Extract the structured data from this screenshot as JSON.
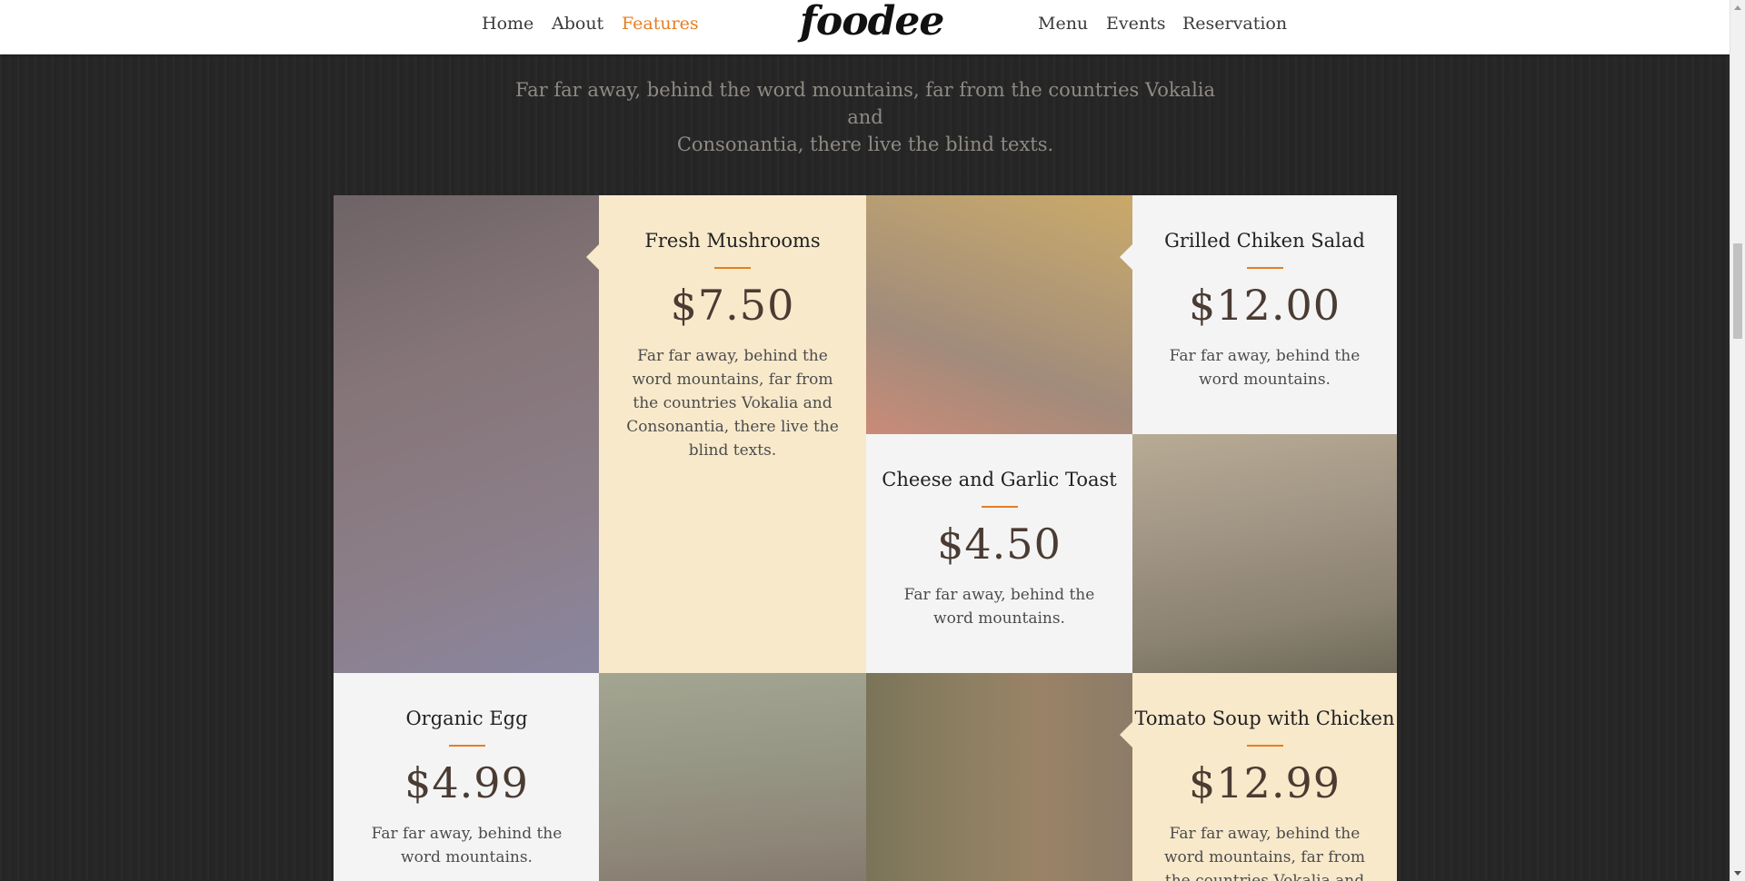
{
  "nav": {
    "left": [
      "Home",
      "About",
      "Features"
    ],
    "active": "Features",
    "right": [
      "Menu",
      "Events",
      "Reservation"
    ],
    "logo": "foodee",
    "accent_color": "#e67e22"
  },
  "intro": {
    "line1": "Far far away, behind the word mountains, far from the countries Vokalia and",
    "line2": "Consonantia, there live the blind texts."
  },
  "menu": [
    {
      "title": "Fresh Mushrooms",
      "price": "$7.50",
      "description": "Far far away, behind the word mountains, far from the countries Vokalia and Consonantia, there live the blind texts."
    },
    {
      "title": "Grilled Chiken Salad",
      "price": "$12.00",
      "description": "Far far away, behind the word mountains."
    },
    {
      "title": "Cheese and Garlic Toast",
      "price": "$4.50",
      "description": "Far far away, behind the word mountains."
    },
    {
      "title": "Organic Egg",
      "price": "$4.99",
      "description": "Far far away, behind the word mountains."
    },
    {
      "title": "Tomato Soup with Chicken",
      "price": "$12.99",
      "description": "Far far away, behind the word mountains, far from the countries Vokalia and"
    }
  ],
  "images": [
    {
      "icon": "mushroom-photo"
    },
    {
      "icon": "salad-photo"
    },
    {
      "icon": "toast-photo"
    },
    {
      "icon": "egg-photo"
    },
    {
      "icon": "soup-photo"
    }
  ]
}
